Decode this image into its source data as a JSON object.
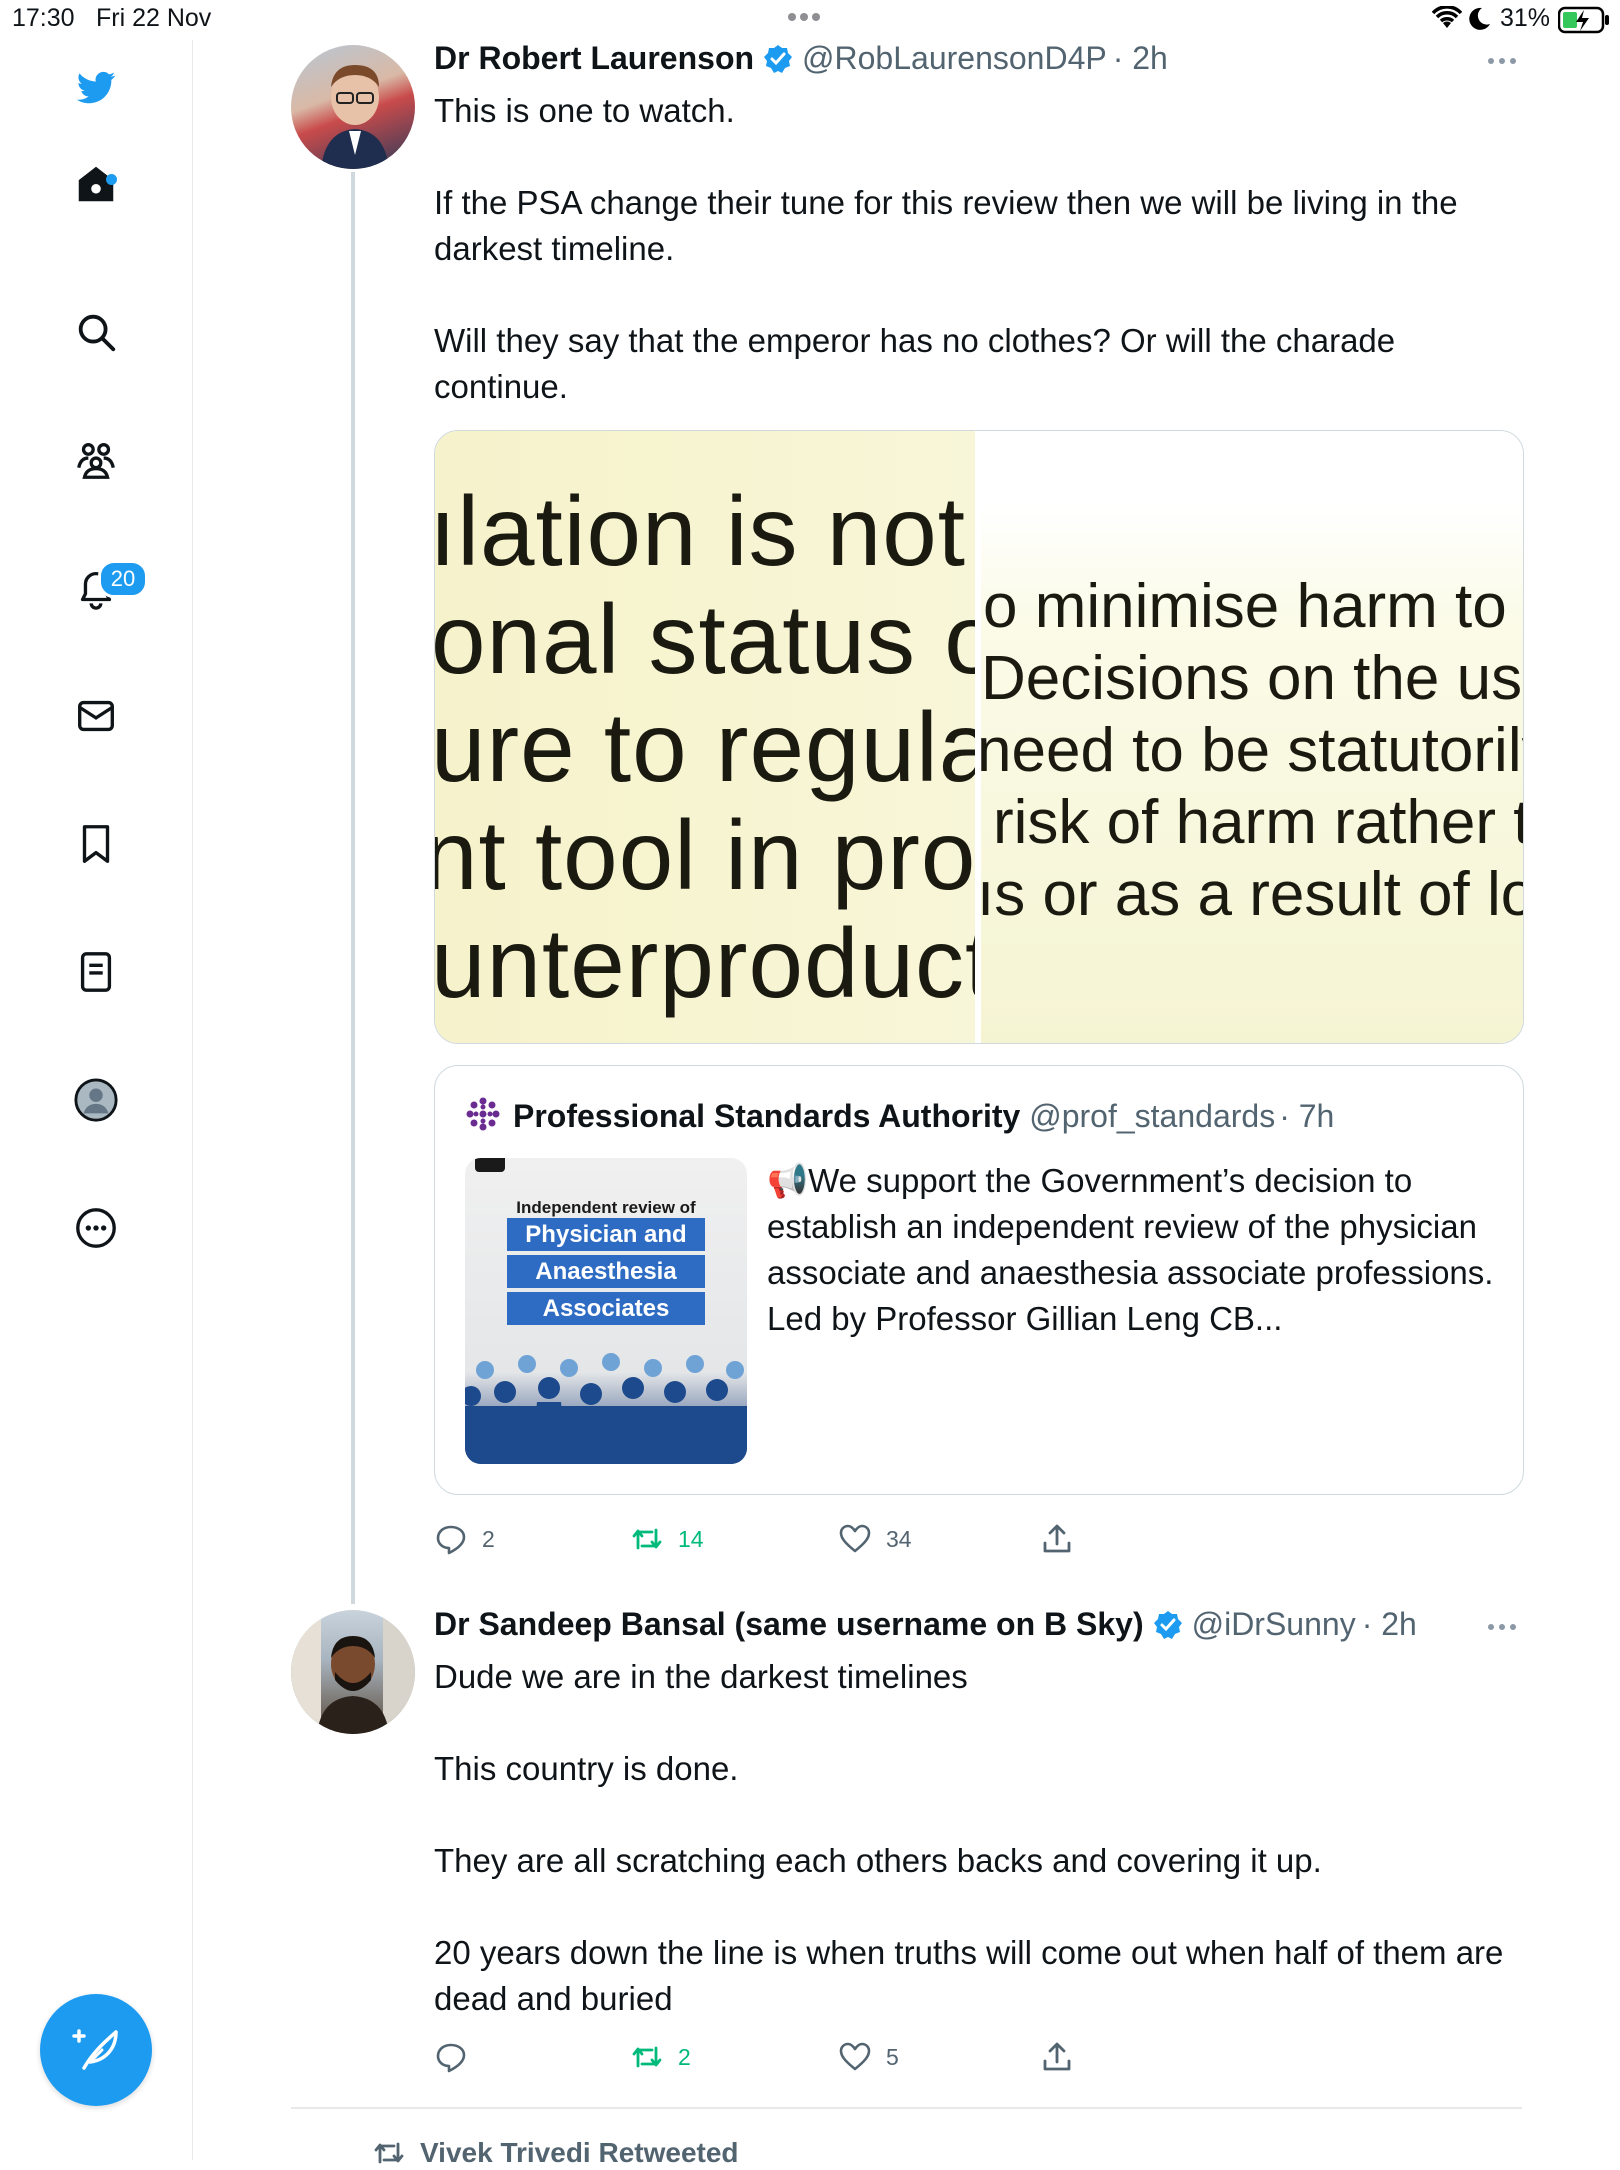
{
  "status_bar": {
    "time": "17:30",
    "date": "Fri 22 Nov",
    "battery": "31%"
  },
  "sidebar": {
    "icons": [
      "twitter-logo-icon",
      "home-icon",
      "search-icon",
      "communities-icon",
      "bell-icon",
      "mail-icon",
      "bookmark-icon",
      "lists-icon",
      "profile-icon",
      "more-circle-icon"
    ],
    "notification_badge": "20",
    "accent": "#1d9bf0"
  },
  "tweets": [
    {
      "name": "Dr Robert Laurenson",
      "handle": "@RobLaurensonD4P",
      "time": "· 2h",
      "paragraphs": [
        "This is one to watch.",
        "If the PSA change their tune for this review then we will be living in the darkest timeline.",
        "Will they say that the emperor has no clothes? Or will the charade continue."
      ],
      "media": {
        "left_lines": [
          "ılation is not u",
          "onal status o",
          "ure to regula",
          "nt tool in prote",
          "unterproducti"
        ],
        "right_lines": [
          "o minimise harm to",
          "Decisions on the use",
          "need to be statutorily",
          "risk of harm rather t",
          "ıs or as a result of lo"
        ]
      },
      "quote": {
        "name": "Professional Standards Authority",
        "handle": "@prof_standards",
        "time": "· 7h",
        "thumbnail": {
          "title": "Independent review of",
          "pill1": "Physician and",
          "pill2": "Anaesthesia",
          "pill3": "Associates"
        },
        "text": "📢We support the Government’s decision to establish an independent review of the physician associate and anaesthesia associate professions.  Led by Professor Gillian Leng CB..."
      },
      "stats": {
        "replies": "2",
        "retweets": "14",
        "likes": "34"
      }
    },
    {
      "name": "Dr Sandeep Bansal (same username on B Sky)",
      "handle": "@iDrSunny",
      "time": "· 2h",
      "paragraphs": [
        "Dude we are in the darkest timelines",
        "This country is done.",
        "They are all scratching each others backs and covering it up.",
        "20 years down the line is when truths will come out when half of them are dead and buried"
      ],
      "stats": {
        "replies": "",
        "retweets": "2",
        "likes": "5"
      }
    }
  ],
  "next_item": {
    "retweeted_by": "Vivek Trivedi Retweeted"
  }
}
